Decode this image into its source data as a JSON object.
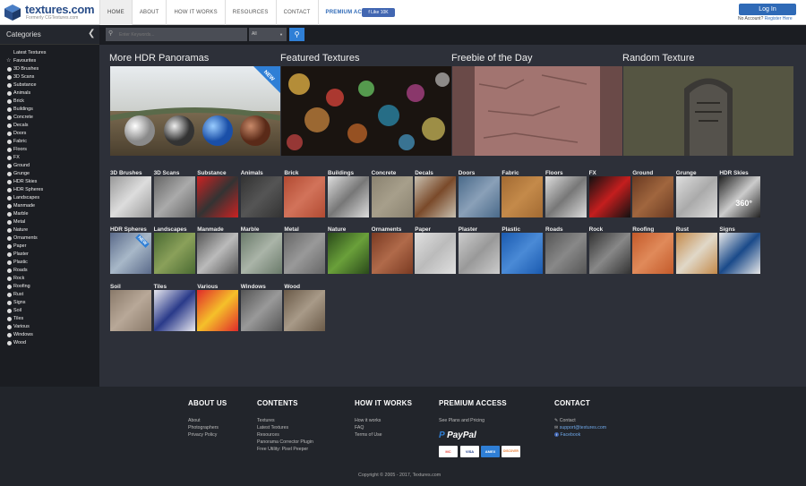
{
  "brand": {
    "name": "textures.com",
    "subtitle": "Formerly CGTextures.com"
  },
  "nav": {
    "items": [
      "HOME",
      "ABOUT",
      "HOW IT WORKS",
      "RESOURCES",
      "CONTACT",
      "PREMIUM ACCESS"
    ]
  },
  "facebook": {
    "label": "Like 10K"
  },
  "account": {
    "login": "Log In",
    "no_account": "No Account?",
    "register": "Register Here"
  },
  "sidebar": {
    "title": "Categories",
    "items": [
      "Latest Textures",
      "Favourites",
      "3D Brushes",
      "3D Scans",
      "Substance",
      "Animals",
      "Brick",
      "Buildings",
      "Concrete",
      "Decals",
      "Doors",
      "Fabric",
      "Floors",
      "FX",
      "Ground",
      "Grunge",
      "HDR Skies",
      "HDR Spheres",
      "Landscapes",
      "Manmade",
      "Marble",
      "Metal",
      "Nature",
      "Ornaments",
      "Paper",
      "Plaster",
      "Plastic",
      "Roads",
      "Rock",
      "Roofing",
      "Rust",
      "Signs",
      "Soil",
      "Tiles",
      "Various",
      "Windows",
      "Wood"
    ]
  },
  "search": {
    "placeholder": "Enter Keywords...",
    "select": "All"
  },
  "featured": [
    {
      "title": "More HDR Panoramas",
      "badge": "NEW"
    },
    {
      "title": "Featured Textures"
    },
    {
      "title": "Freebie of the Day"
    },
    {
      "title": "Random Texture"
    }
  ],
  "categories": [
    "3D Brushes",
    "3D Scans",
    "Substance",
    "Animals",
    "Brick",
    "Buildings",
    "Concrete",
    "Decals",
    "Doors",
    "Fabric",
    "Floors",
    "FX",
    "Ground",
    "Grunge",
    "HDR Skies",
    "HDR Spheres",
    "Landscapes",
    "Manmade",
    "Marble",
    "Metal",
    "Nature",
    "Ornaments",
    "Paper",
    "Plaster",
    "Plastic",
    "Roads",
    "Rock",
    "Roofing",
    "Rust",
    "Signs",
    "Soil",
    "Tiles",
    "Various",
    "Windows",
    "Wood"
  ],
  "hdr_skies_badge": "360°",
  "hdr_spheres_badge": "NEW",
  "footer": {
    "about": {
      "head": "ABOUT US",
      "links": [
        "About",
        "Photographers",
        "Privacy Policy"
      ]
    },
    "contents": {
      "head": "CONTENTS",
      "links": [
        "Textures",
        "Latest Textures",
        "Resources",
        "Panorama Corrector Plugin",
        "Free Utility: Pixel Peeper"
      ]
    },
    "how": {
      "head": "HOW IT WORKS",
      "links": [
        "How it works",
        "FAQ",
        "Terms of Use"
      ]
    },
    "premium": {
      "head": "PREMIUM ACCESS",
      "links": [
        "See Plans and Pricing"
      ],
      "paypal": "PayPal",
      "cards": [
        "MC",
        "VISA",
        "AMEX",
        "DISCOVER"
      ]
    },
    "contact": {
      "head": "CONTACT",
      "links": [
        "Contact",
        "support@textures.com",
        "Facebook"
      ]
    },
    "copyright": "Copyright © 2005 - 2017, Textures.com"
  }
}
